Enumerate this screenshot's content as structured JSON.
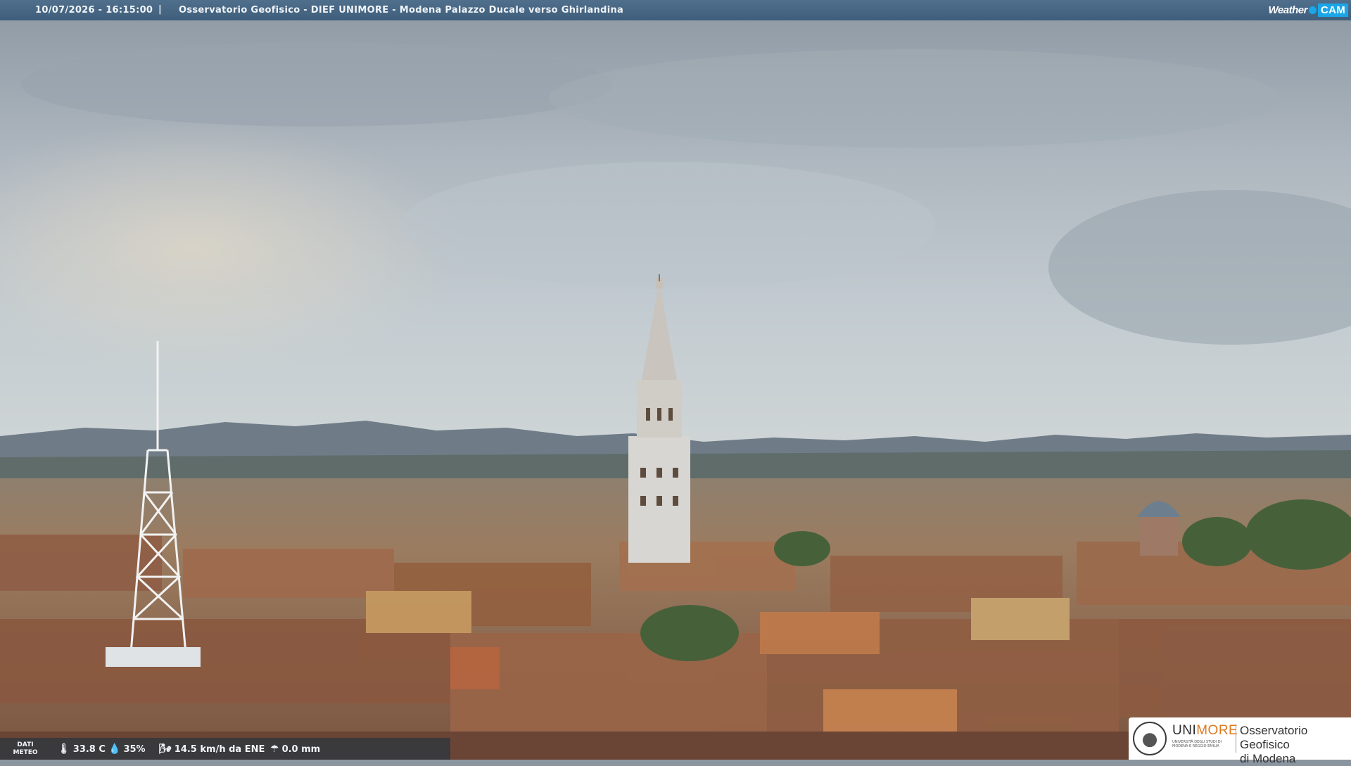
{
  "header": {
    "timestamp": "10/07/2026 - 16:15:00",
    "separator": "|",
    "title": "Osservatorio Geofisico - DIEF UNIMORE - Modena Palazzo Ducale verso Ghirlandina"
  },
  "logo": {
    "weather": "Weather",
    "cam": "CAM"
  },
  "meteo": {
    "label_line1": "DATI",
    "label_line2": "METEO",
    "temperature": "33.8 C",
    "humidity": "35%",
    "wind": "14.5 km/h da ENE",
    "rain": "0.0 mm",
    "icons": [
      "thermometer-icon",
      "humidity-drop-icon",
      "wind-icon",
      "rain-icon"
    ]
  },
  "badge": {
    "uni_prefix": "UNI",
    "uni_suffix": "MORE",
    "uni_sub": "UNIVERSITÀ DEGLI STUDI DI MODENA E REGGIO EMILIA",
    "observatory_line1": "Osservatorio Geofisico",
    "observatory_line2": "di Modena"
  },
  "colors": {
    "topbar": "#46667f",
    "sky": "#b9c3c8",
    "roofs": "#9c6a4c",
    "accent_cam": "#1aa6e8",
    "unimore_orange": "#e07a1e"
  }
}
